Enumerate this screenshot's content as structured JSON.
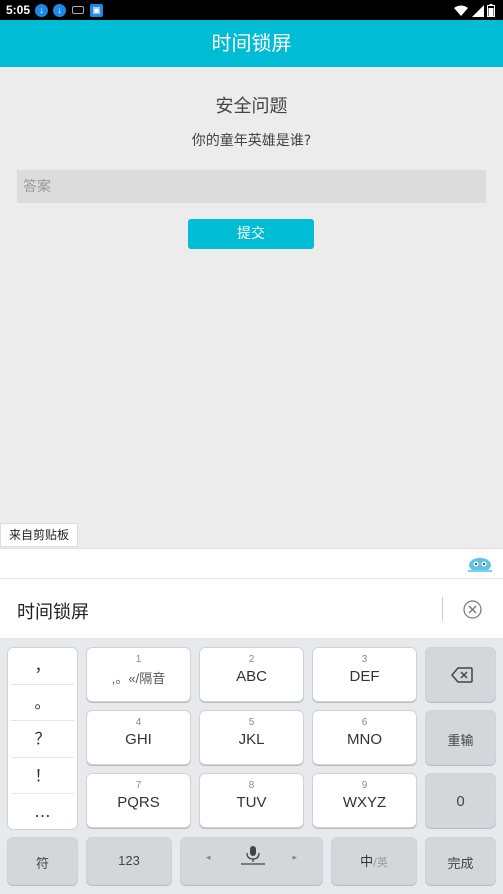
{
  "status_bar": {
    "time": "5:05"
  },
  "app_bar": {
    "title": "时间锁屏"
  },
  "security": {
    "title": "安全问题",
    "question": "你的童年英雄是谁?",
    "answer_placeholder": "答案",
    "answer_value": "",
    "submit_label": "提交"
  },
  "clipboard": {
    "label": "来自剪贴板"
  },
  "ime": {
    "composing_text": "时间锁屏",
    "punctuation": [
      "，",
      "。",
      "？",
      "！",
      "…"
    ],
    "keys": [
      {
        "num": "1",
        "label": ",。«/隔音"
      },
      {
        "num": "2",
        "label": "ABC"
      },
      {
        "num": "3",
        "label": "DEF"
      },
      {
        "num": "4",
        "label": "GHI"
      },
      {
        "num": "5",
        "label": "JKL"
      },
      {
        "num": "6",
        "label": "MNO"
      },
      {
        "num": "7",
        "label": "PQRS"
      },
      {
        "num": "8",
        "label": "TUV"
      },
      {
        "num": "9",
        "label": "WXYZ"
      }
    ],
    "reenter_label": "重输",
    "zero_label": "0",
    "symbol_label": "符",
    "numeric_label": "123",
    "lang_primary": "中",
    "lang_secondary": "/英",
    "done_label": "完成"
  }
}
